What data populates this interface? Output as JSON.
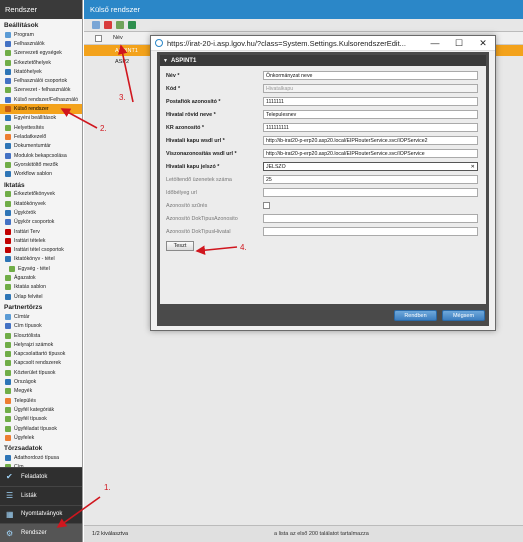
{
  "sidebar": {
    "title": "Rendszer",
    "sections": [
      {
        "title": "Beállítások",
        "items": [
          {
            "label": "Program",
            "color": "#5b9bd5"
          },
          {
            "label": "Felhasználók",
            "color": "#4472c4"
          },
          {
            "label": "Szervezeti egységek",
            "color": "#70ad47"
          },
          {
            "label": "Érkeztetőhelyek",
            "color": "#70ad47"
          },
          {
            "label": "Iktatóhelyek",
            "color": "#2e75b6"
          },
          {
            "label": "Felhasználói csoportok",
            "color": "#4472c4"
          },
          {
            "label": "Szervezet - felhasználók",
            "color": "#70ad47"
          },
          {
            "label": "Külső rendszer/Felhasználó",
            "color": "#4472c4"
          },
          {
            "label": "Külső rendszer",
            "color": "#c55a11",
            "active": true
          },
          {
            "label": "Egyéni beállítások",
            "color": "#2e75b6"
          },
          {
            "label": "Helyettesítés",
            "color": "#70ad47"
          },
          {
            "label": "Feladatkezelő",
            "color": "#ed7d31"
          },
          {
            "label": "Dokumentumtár",
            "color": "#2e75b6"
          },
          {
            "label": "Modulok bekapcsolása",
            "color": "#4472c4"
          },
          {
            "label": "Gyorskitöltő mezők",
            "color": "#70ad47"
          },
          {
            "label": "Workflow sablon",
            "color": "#2e75b6"
          }
        ]
      },
      {
        "title": "Iktatás",
        "items": [
          {
            "label": "Érkeztetőkönyvek",
            "color": "#70ad47"
          },
          {
            "label": "Iktatókönyvek",
            "color": "#70ad47"
          },
          {
            "label": "Ügykörök",
            "color": "#2e75b6"
          },
          {
            "label": "Ügykör csoportok",
            "color": "#4472c4"
          },
          {
            "label": "Irattári Terv",
            "color": "#c00000"
          },
          {
            "label": "Irattári tételek",
            "color": "#c00000"
          },
          {
            "label": "Irattári tétel csoportok",
            "color": "#c00000"
          },
          {
            "label": "Iktatókönyv - tétel",
            "color": "#2e75b6"
          },
          {
            "label": "Egység - tétel",
            "color": "#70ad47",
            "sub": true
          },
          {
            "label": "Ágazatok",
            "color": "#70ad47"
          },
          {
            "label": "Iktatás sablon",
            "color": "#70ad47"
          },
          {
            "label": "Űrlap felvitel",
            "color": "#2e75b6"
          }
        ]
      },
      {
        "title": "Partnertörzs",
        "items": [
          {
            "label": "Címtár",
            "color": "#5b9bd5"
          },
          {
            "label": "Cím típusok",
            "color": "#4472c4"
          },
          {
            "label": "Elosztólista",
            "color": "#70ad47"
          },
          {
            "label": "Helyrajzi számok",
            "color": "#70ad47"
          },
          {
            "label": "Kapcsolattartó típusok",
            "color": "#70ad47"
          },
          {
            "label": "Kapcsolt rendszerek",
            "color": "#70ad47"
          },
          {
            "label": "Közterület típusok",
            "color": "#70ad47"
          },
          {
            "label": "Országok",
            "color": "#2e75b6"
          },
          {
            "label": "Megyék",
            "color": "#70ad47"
          },
          {
            "label": "Település",
            "color": "#ed7d31"
          },
          {
            "label": "Ügyfél kategóriák",
            "color": "#70ad47"
          },
          {
            "label": "Ügyfél típusok",
            "color": "#70ad47"
          },
          {
            "label": "Ügyféladat típusok",
            "color": "#70ad47"
          },
          {
            "label": "Ügyfelek",
            "color": "#ed7d31"
          }
        ]
      },
      {
        "title": "Törzsadatok",
        "items": [
          {
            "label": "Adathordozó típusa",
            "color": "#2e75b6"
          },
          {
            "label": "Cím...",
            "color": "#70ad47"
          }
        ]
      }
    ],
    "nav": [
      {
        "label": "Feladatok",
        "icon": "✔"
      },
      {
        "label": "Listák",
        "icon": "☰"
      },
      {
        "label": "Nyomtatványok",
        "icon": "▦"
      },
      {
        "label": "Rendszer",
        "icon": "⚙",
        "active": true
      }
    ]
  },
  "main": {
    "title": "Külső rendszer",
    "grid": {
      "column_header": "Név",
      "rows": [
        {
          "label": "ASPINT1",
          "selected": true
        },
        {
          "label": "ASP2",
          "selected": false
        }
      ]
    },
    "footer": {
      "left": "1/2 kiválasztva",
      "right": "a lista az első 200 találatot tartalmazza"
    }
  },
  "dialog": {
    "title": "https://irat-20-i.asp.lgov.hu/?class=System.Settings.KulsorendszerEdit...",
    "panel_title": "ASPINT1",
    "fields": [
      {
        "label": "Név *",
        "value": "Önkormányzat neve",
        "bold": true,
        "type": "text"
      },
      {
        "label": "Kód *",
        "value": "Hivatalkapu",
        "bold": true,
        "type": "disabled"
      },
      {
        "label": "Postafiók azonosító *",
        "value": "1111111",
        "bold": true,
        "type": "text"
      },
      {
        "label": "Hivatal rövid neve *",
        "value": "Telepulesnev",
        "bold": true,
        "type": "text"
      },
      {
        "label": "KR azonosító *",
        "value": "111111111",
        "bold": true,
        "type": "text"
      },
      {
        "label": "Hivatali kapu wsdl url *",
        "value": "http://ib-irat20-p-erp20.asp20.local/EIPRouterService.svc/IOPService2",
        "bold": true,
        "type": "text"
      },
      {
        "label": "Viszonazonosítás wsdl url *",
        "value": "http://ib-irat20-p-erp20.asp20.local/EIPRouterService.svc/IOPService",
        "bold": true,
        "type": "text"
      },
      {
        "label": "Hivatali kapu jelszó *",
        "value": "JELSZO",
        "bold": true,
        "type": "active"
      },
      {
        "label": "Letöltendő üzenetek száma",
        "value": "25",
        "bold": false,
        "type": "text"
      },
      {
        "label": "Időbélyeg url",
        "value": "",
        "bold": false,
        "type": "text"
      },
      {
        "label": "Azonosító szűrés",
        "value": "",
        "bold": false,
        "type": "checkbox"
      },
      {
        "label": "Azonosító DokTipusAzonosito",
        "value": "",
        "bold": false,
        "type": "text"
      },
      {
        "label": "Azonosító DokTipusHivatal",
        "value": "",
        "bold": false,
        "type": "text"
      }
    ],
    "test_button": "Teszt",
    "clear_glyph": "✕",
    "save_button": "Rendben",
    "cancel_button": "Mégsem",
    "window_controls": {
      "minimize": "—",
      "maximize": "☐",
      "close": "✕"
    }
  },
  "annotations": {
    "color": "#d0161e",
    "labels": [
      "1.",
      "2.",
      "3.",
      "4."
    ]
  }
}
